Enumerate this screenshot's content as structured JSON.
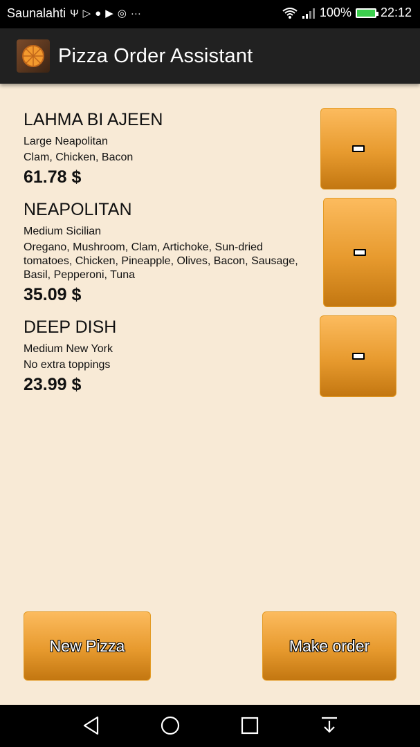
{
  "status_bar": {
    "carrier": "Saunalahti",
    "battery": "100%",
    "time": "22:12"
  },
  "app_bar": {
    "title": "Pizza Order Assistant"
  },
  "pizzas": [
    {
      "name": "LAHMA BI AJEEN",
      "base": "Large Neapolitan",
      "toppings": "Clam, Chicken, Bacon",
      "price": "61.78 $"
    },
    {
      "name": "NEAPOLITAN",
      "base": "Medium Sicilian",
      "toppings": "Oregano, Mushroom, Clam, Artichoke, Sun-dried tomatoes, Chicken, Pineapple, Olives, Bacon, Sausage, Basil, Pepperoni, Tuna",
      "price": "35.09 $"
    },
    {
      "name": "DEEP DISH",
      "base": "Medium New York",
      "toppings": "No extra toppings",
      "price": "23.99 $"
    }
  ],
  "actions": {
    "new_pizza": "New Pizza",
    "make_order": "Make order"
  },
  "colors": {
    "background": "#f8ead6",
    "button_top": "#fcbb5e",
    "button_bottom": "#c37711",
    "app_bar": "#212121"
  }
}
